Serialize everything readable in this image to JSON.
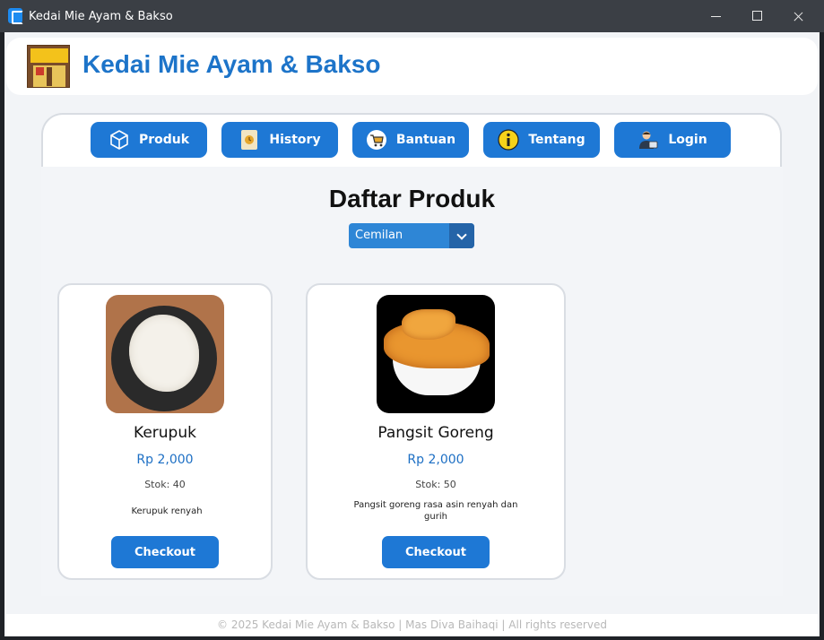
{
  "window": {
    "title": "Kedai Mie Ayam & Bakso"
  },
  "header": {
    "title": "Kedai Mie Ayam & Bakso",
    "logo_text": "MIE AYAM & BAKSO"
  },
  "nav": {
    "items": [
      {
        "label": "Produk",
        "icon": "box-icon"
      },
      {
        "label": "History",
        "icon": "clock-icon"
      },
      {
        "label": "Bantuan",
        "icon": "cart-icon"
      },
      {
        "label": "Tentang",
        "icon": "info-icon"
      },
      {
        "label": "Login",
        "icon": "user-icon"
      }
    ]
  },
  "main": {
    "title": "Daftar Produk",
    "category_select": {
      "value": "Cemilan"
    },
    "products": [
      {
        "name": "Kerupuk",
        "price": "Rp 2,000",
        "stock": "Stok: 40",
        "description": "Kerupuk renyah",
        "button": "Checkout"
      },
      {
        "name": "Pangsit Goreng",
        "price": "Rp 2,000",
        "stock": "Stok: 50",
        "description": "Pangsit goreng rasa asin renyah dan gurih",
        "button": "Checkout"
      }
    ]
  },
  "footer": {
    "text": "© 2025 Kedai Mie Ayam & Bakso | Mas Diva Baihaqi | All rights reserved"
  },
  "colors": {
    "accent": "#1e78d5",
    "brand_title": "#1d74c9",
    "titlebar": "#3b3f45"
  }
}
